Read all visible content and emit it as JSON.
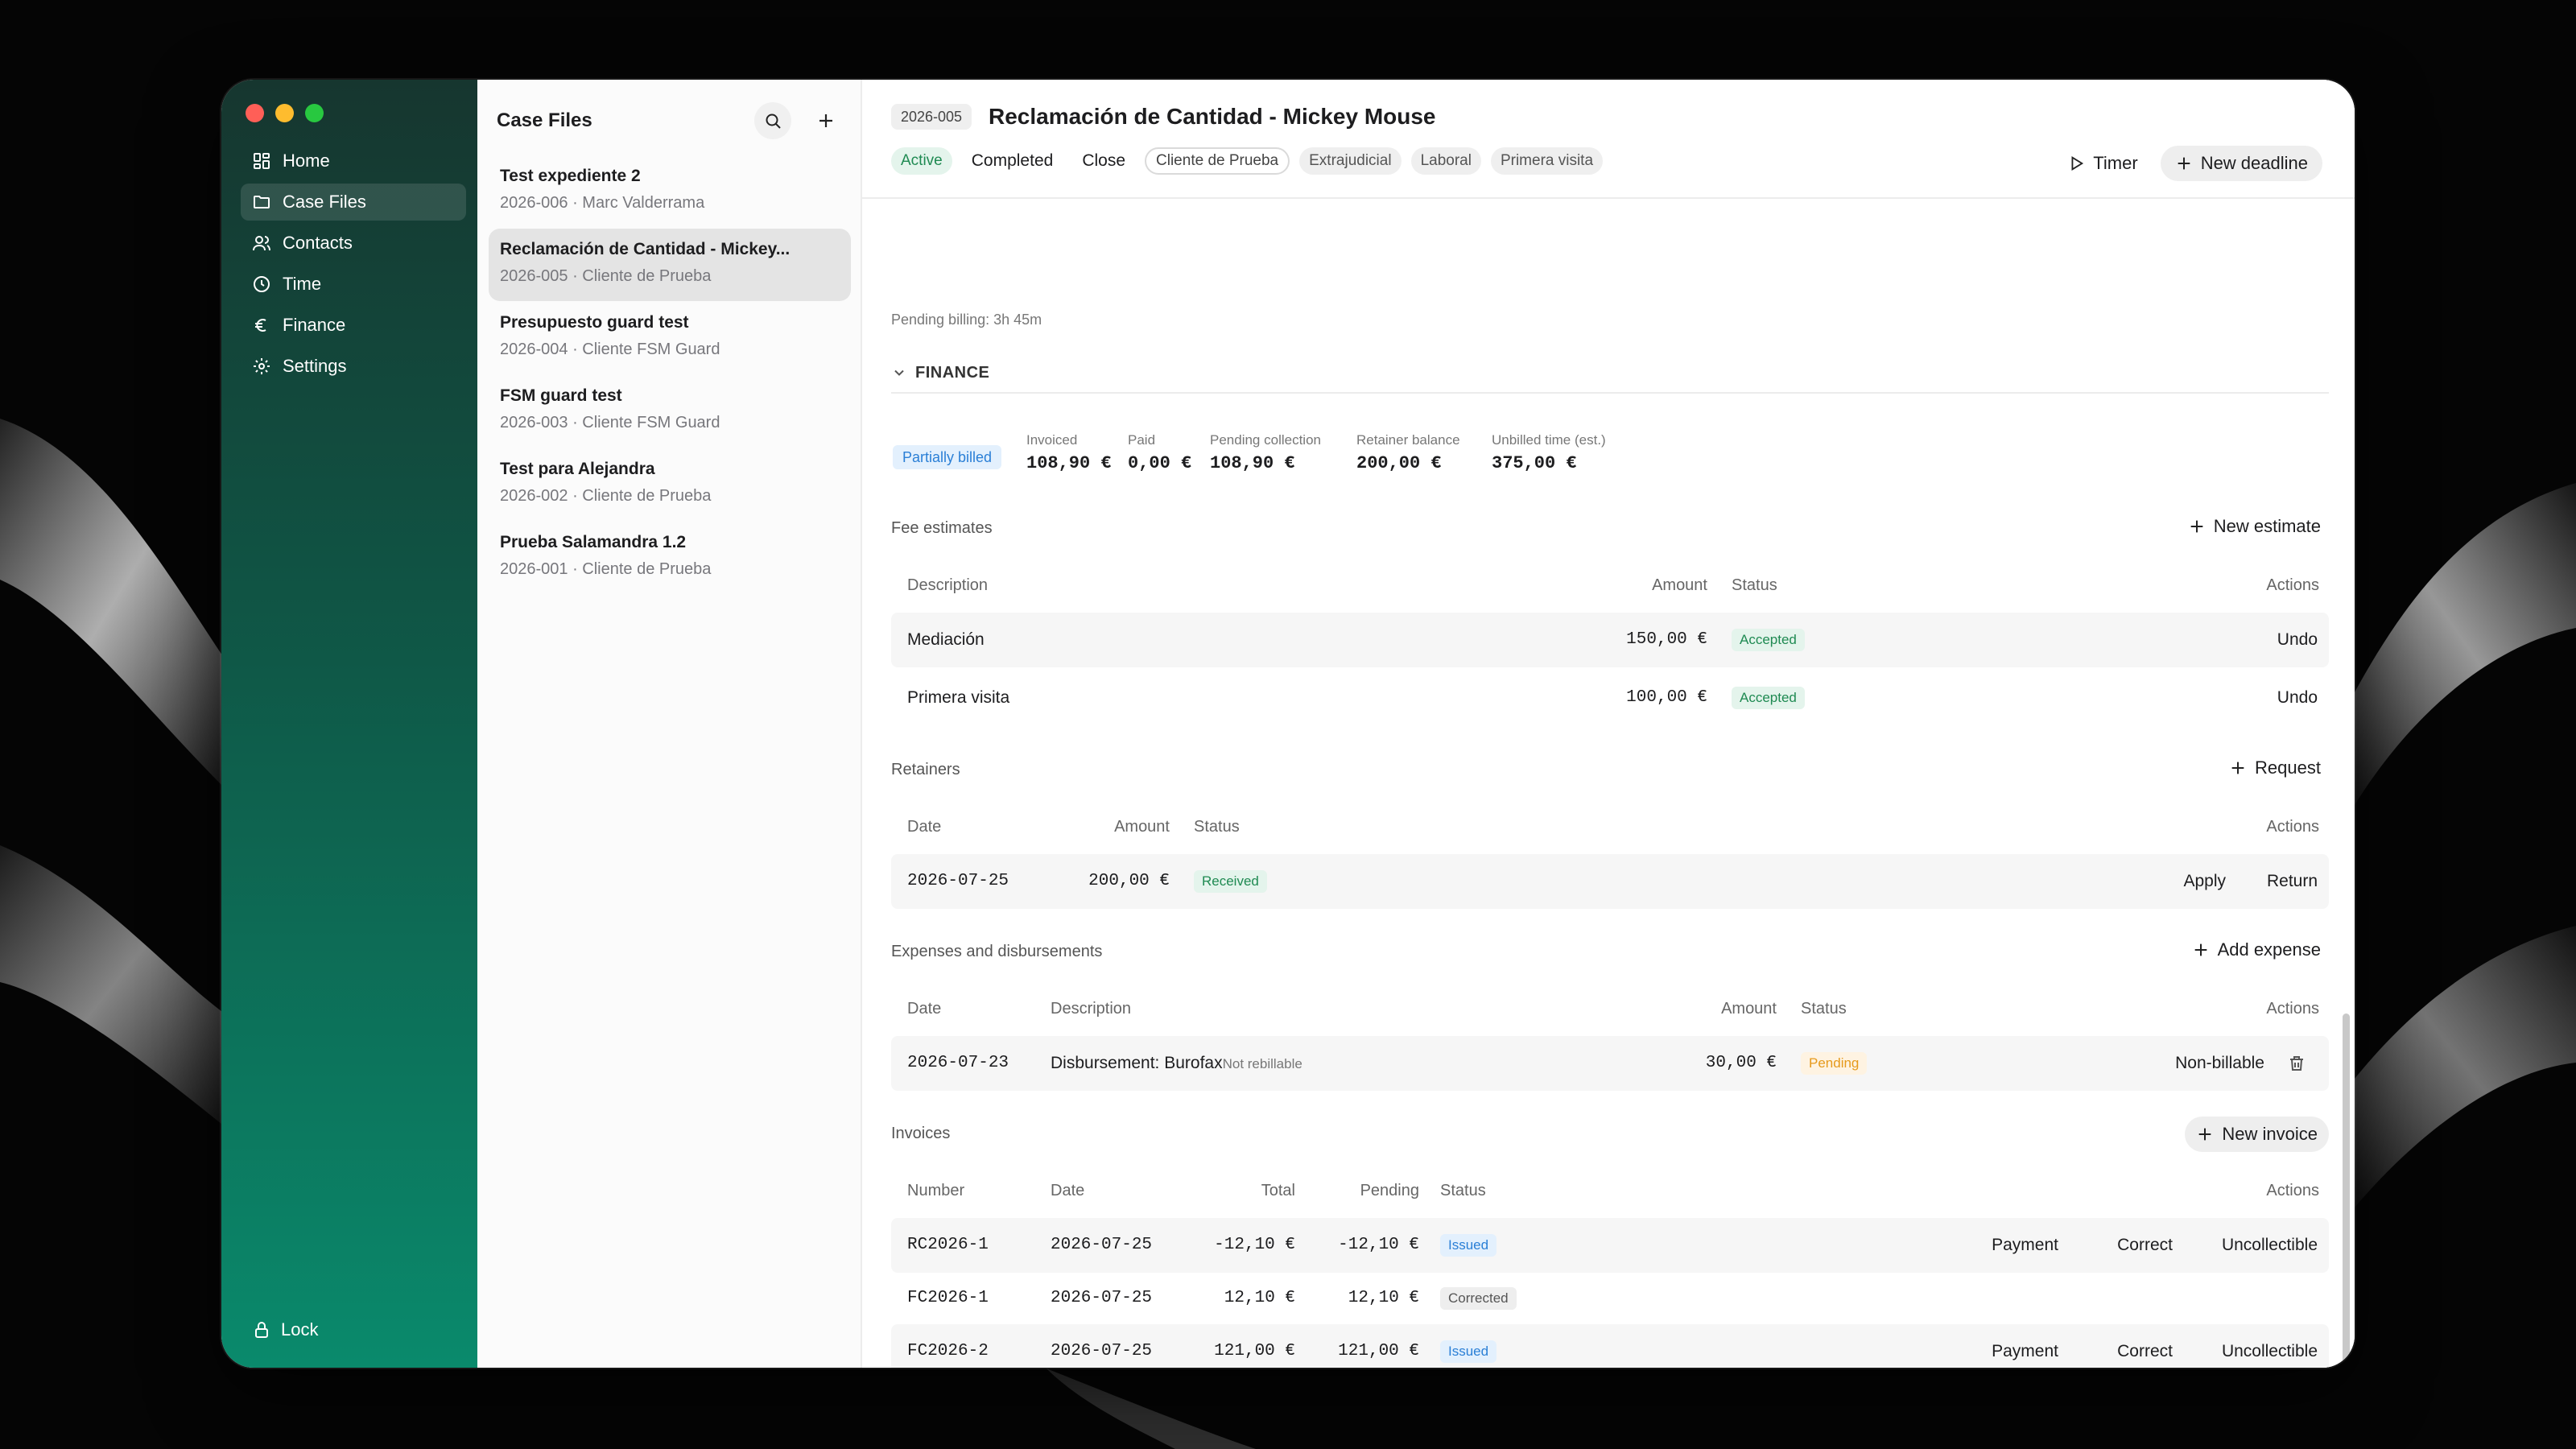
{
  "sidebar": {
    "items": [
      {
        "label": "Home",
        "icon": "home-grid-icon"
      },
      {
        "label": "Case Files",
        "icon": "folder-icon"
      },
      {
        "label": "Contacts",
        "icon": "contacts-icon"
      },
      {
        "label": "Time",
        "icon": "clock-icon"
      },
      {
        "label": "Finance",
        "icon": "euro-icon"
      },
      {
        "label": "Settings",
        "icon": "gear-icon"
      }
    ],
    "active_item": "Case Files",
    "lock_label": "Lock"
  },
  "case_list": {
    "title": "Case Files",
    "items": [
      {
        "name": "Test expediente 2",
        "sub": "2026-006 · Marc Valderrama"
      },
      {
        "name": "Reclamación de Cantidad - Mickey...",
        "sub": "2026-005 · Cliente de Prueba"
      },
      {
        "name": "Presupuesto guard test",
        "sub": "2026-004 · Cliente FSM Guard"
      },
      {
        "name": "FSM guard test",
        "sub": "2026-003 · Cliente FSM Guard"
      },
      {
        "name": "Test para Alejandra",
        "sub": "2026-002 · Cliente de Prueba"
      },
      {
        "name": "Prueba Salamandra 1.2",
        "sub": "2026-001 · Cliente de Prueba"
      }
    ]
  },
  "header": {
    "case_id": "2026-005",
    "title": "Reclamación de Cantidad - Mickey Mouse",
    "status": "Active",
    "completed_label": "Completed",
    "close_label": "Close",
    "client_tag": "Cliente de Prueba",
    "tags": [
      "Extrajudicial",
      "Laboral",
      "Primera visita"
    ],
    "timer_label": "Timer",
    "new_deadline_label": "New deadline"
  },
  "content": {
    "pending_billing": "Pending billing: 3h 45m",
    "finance": {
      "title": "FINANCE",
      "billing_status": "Partially billed",
      "stats": [
        {
          "label": "Invoiced",
          "value": "108,90 €"
        },
        {
          "label": "Paid",
          "value": "0,00 €"
        },
        {
          "label": "Pending collection",
          "value": "108,90 €"
        },
        {
          "label": "Retainer balance",
          "value": "200,00 €"
        },
        {
          "label": "Unbilled time (est.)",
          "value": "375,00 €"
        }
      ]
    },
    "fee_estimates": {
      "title": "Fee estimates",
      "action": "New estimate",
      "columns": [
        "Description",
        "Amount",
        "Status",
        "Actions"
      ],
      "rows": [
        {
          "description": "Mediación",
          "amount": "150,00 €",
          "status": "Accepted",
          "action": "Undo"
        },
        {
          "description": "Primera visita",
          "amount": "100,00 €",
          "status": "Accepted",
          "action": "Undo"
        }
      ]
    },
    "retainers": {
      "title": "Retainers",
      "action": "Request",
      "columns": [
        "Date",
        "Amount",
        "Status",
        "Actions"
      ],
      "rows": [
        {
          "date": "2026-07-25",
          "amount": "200,00 €",
          "status": "Received",
          "actions": [
            "Apply",
            "Return"
          ]
        }
      ]
    },
    "expenses": {
      "title": "Expenses and disbursements",
      "action": "Add expense",
      "columns": [
        "Date",
        "Description",
        "Amount",
        "Status",
        "Actions"
      ],
      "rows": [
        {
          "date": "2026-07-23",
          "description": "Disbursement: Burofax",
          "note": "Not rebillable",
          "amount": "30,00 €",
          "status": "Pending",
          "action": "Non-billable"
        }
      ]
    },
    "invoices": {
      "title": "Invoices",
      "action": "New invoice",
      "columns": [
        "Number",
        "Date",
        "Total",
        "Pending",
        "Status",
        "Actions"
      ],
      "rows": [
        {
          "number": "RC2026-1",
          "date": "2026-07-25",
          "total": "-12,10 €",
          "pending": "-12,10 €",
          "status": "Issued",
          "actions": [
            "Payment",
            "Correct",
            "Uncollectible"
          ]
        },
        {
          "number": "FC2026-1",
          "date": "2026-07-25",
          "total": "12,10 €",
          "pending": "12,10 €",
          "status": "Corrected",
          "actions": []
        },
        {
          "number": "FC2026-2",
          "date": "2026-07-25",
          "total": "121,00 €",
          "pending": "121,00 €",
          "status": "Issued",
          "actions": [
            "Payment",
            "Correct",
            "Uncollectible"
          ]
        }
      ]
    }
  },
  "colors": {
    "accent_green": "#1f8a52",
    "accent_blue": "#2a7fd6",
    "pending_orange": "#e69a1c",
    "sidebar_top": "#16362f",
    "sidebar_bottom": "#0a8a6c"
  }
}
